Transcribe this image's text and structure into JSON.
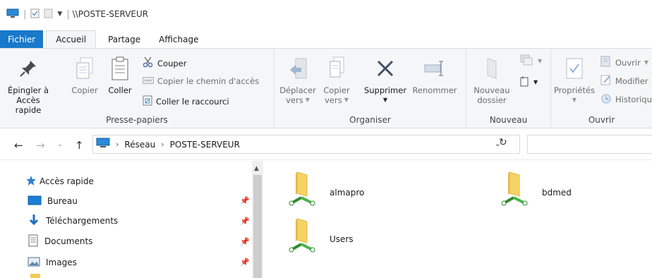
{
  "window": {
    "title": "\\\\POSTE-SERVEUR"
  },
  "tabs": {
    "file": "Fichier",
    "home": "Accueil",
    "share": "Partage",
    "view": "Affichage"
  },
  "ribbon": {
    "clipboard": {
      "label": "Presse-papiers",
      "pin_line1": "Épingler à",
      "pin_line2": "Accès rapide",
      "copy": "Copier",
      "paste": "Coller",
      "cut": "Couper",
      "copy_path": "Copier le chemin d'accès",
      "paste_shortcut": "Coller le raccourci"
    },
    "organize": {
      "label": "Organiser",
      "move_line1": "Déplacer",
      "move_line2": "vers",
      "copyto_line1": "Copier",
      "copyto_line2": "vers",
      "delete": "Supprimer",
      "rename": "Renommer"
    },
    "new": {
      "label": "Nouveau",
      "folder_line1": "Nouveau",
      "folder_line2": "dossier"
    },
    "open": {
      "label": "Ouvrir",
      "properties": "Propriétés",
      "open": "Ouvrir",
      "edit": "Modifier",
      "history": "Historique"
    }
  },
  "address": {
    "crumbs": [
      "Réseau",
      "POSTE-SERVEUR"
    ]
  },
  "navpane": {
    "quick_access": "Accès rapide",
    "items": [
      "Bureau",
      "Téléchargements",
      "Documents",
      "Images"
    ]
  },
  "content": {
    "items": [
      "almapro",
      "bdmed",
      "Users"
    ]
  },
  "colors": {
    "accent": "#1979ca",
    "folder": "#f6d365",
    "pipe": "#3aa83a"
  }
}
